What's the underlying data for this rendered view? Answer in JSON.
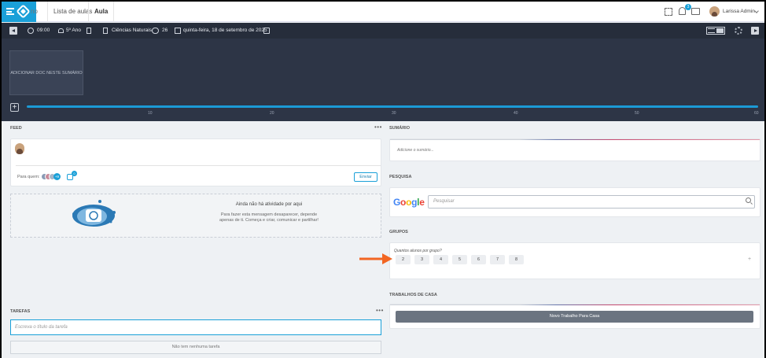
{
  "nav": {
    "tabs": [
      {
        "label": "no"
      },
      {
        "label": "Lista de aulas"
      },
      {
        "label": "Aula"
      }
    ],
    "notifications_count": "3",
    "user_name": "Larissa Admin"
  },
  "lesson": {
    "time": "09:00",
    "grade": "5º Ano",
    "subject": "Ciências Naturais",
    "students": "26",
    "date": "quinta-feira, 18 de setembro de 2025",
    "add_doc_label": "ADICIONAR DOC NESTE SUMÁRIO",
    "add_button": "+",
    "timeline_ticks": [
      "10",
      "20",
      "30",
      "40",
      "50",
      "60"
    ]
  },
  "feed": {
    "title": "FEED",
    "menu": "•••",
    "para_quem": "Para quem:",
    "audience_count": "+9",
    "group_badge": "0",
    "send_label": "Enviar",
    "empty_title": "Ainda não há atividade por aqui",
    "empty_sub": "Para fazer esta mensagem desaparecer, depende apenas de ti. Começa e criar, comunicar e partilhar!"
  },
  "tasks": {
    "title": "TAREFAS",
    "menu": "•••",
    "placeholder": "Escreva o título da tarefa",
    "empty": "Não tem nenhuma tarefa"
  },
  "summary": {
    "title": "SUMÁRIO",
    "placeholder": "Adicione o sumário..."
  },
  "research": {
    "title": "PESQUISA",
    "logo_letters": [
      {
        "ch": "G",
        "color": "#4285F4"
      },
      {
        "ch": "o",
        "color": "#EA4335"
      },
      {
        "ch": "o",
        "color": "#FBBC05"
      },
      {
        "ch": "g",
        "color": "#4285F4"
      },
      {
        "ch": "l",
        "color": "#34A853"
      },
      {
        "ch": "e",
        "color": "#EA4335"
      }
    ],
    "search_placeholder": "Pesquisar"
  },
  "groups": {
    "title": "GRUPOS",
    "question": "Quantos alunos por grupo?",
    "options": [
      "2",
      "3",
      "4",
      "5",
      "6",
      "7",
      "8"
    ],
    "more": "+"
  },
  "homework": {
    "title": "TRABALHOS DE CASA",
    "new_button": "Novo Trabalho Para Casa"
  },
  "colors": {
    "brand": "#1aa0d8",
    "header_band": "#2d3546",
    "annotation_arrow": "#f26522"
  }
}
